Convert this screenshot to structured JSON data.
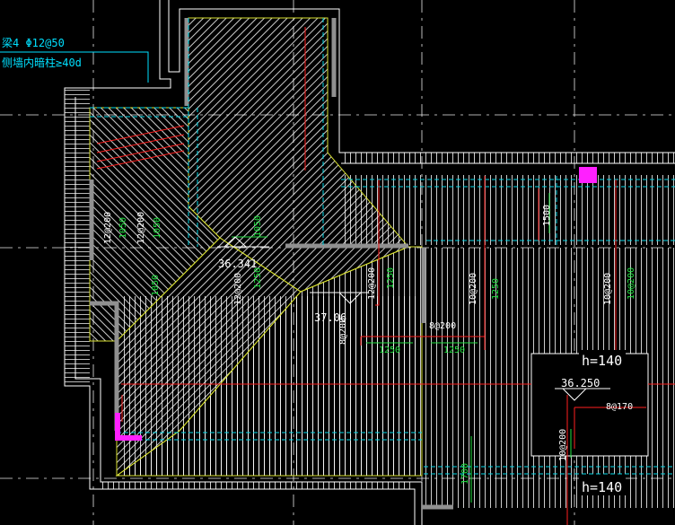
{
  "colors": {
    "background": "#000000",
    "wall": "#ffffff",
    "hatch": "#ffffff",
    "diagonal": "#d8e030",
    "red_rebar": "#ff2020",
    "green_dim": "#20e040",
    "cyan": "#00d8e8",
    "magenta": "#ff20ff",
    "gray_wall": "#909090",
    "note_text": "#00e0ff"
  },
  "notes": {
    "line1": "梁4 Φ12@50",
    "line2": "侧墙内暗柱≥40d"
  },
  "elevations": {
    "peak": "36.341",
    "ridge": "37.06",
    "box": "36.250"
  },
  "slab_thickness": {
    "label_upper": "h=140",
    "label_lower": "h=140"
  },
  "rebar_labels": {
    "r1": "12@200",
    "r2": "12@200",
    "r3": "12@200",
    "r4": "12@200",
    "r5": "8@200",
    "r6": "8@170",
    "r7": "10@200",
    "r8": "10@200",
    "r9": "10@200",
    "r10": "10@200",
    "r11": "8@200"
  },
  "dimensions": {
    "d1": "1050",
    "d2": "1050",
    "d3": "1050",
    "d4": "1050",
    "d5": "1250",
    "d6": "1250",
    "d7": "1250",
    "d8": "1250",
    "d9": "1500",
    "d10": "1250",
    "d11": "1700"
  }
}
